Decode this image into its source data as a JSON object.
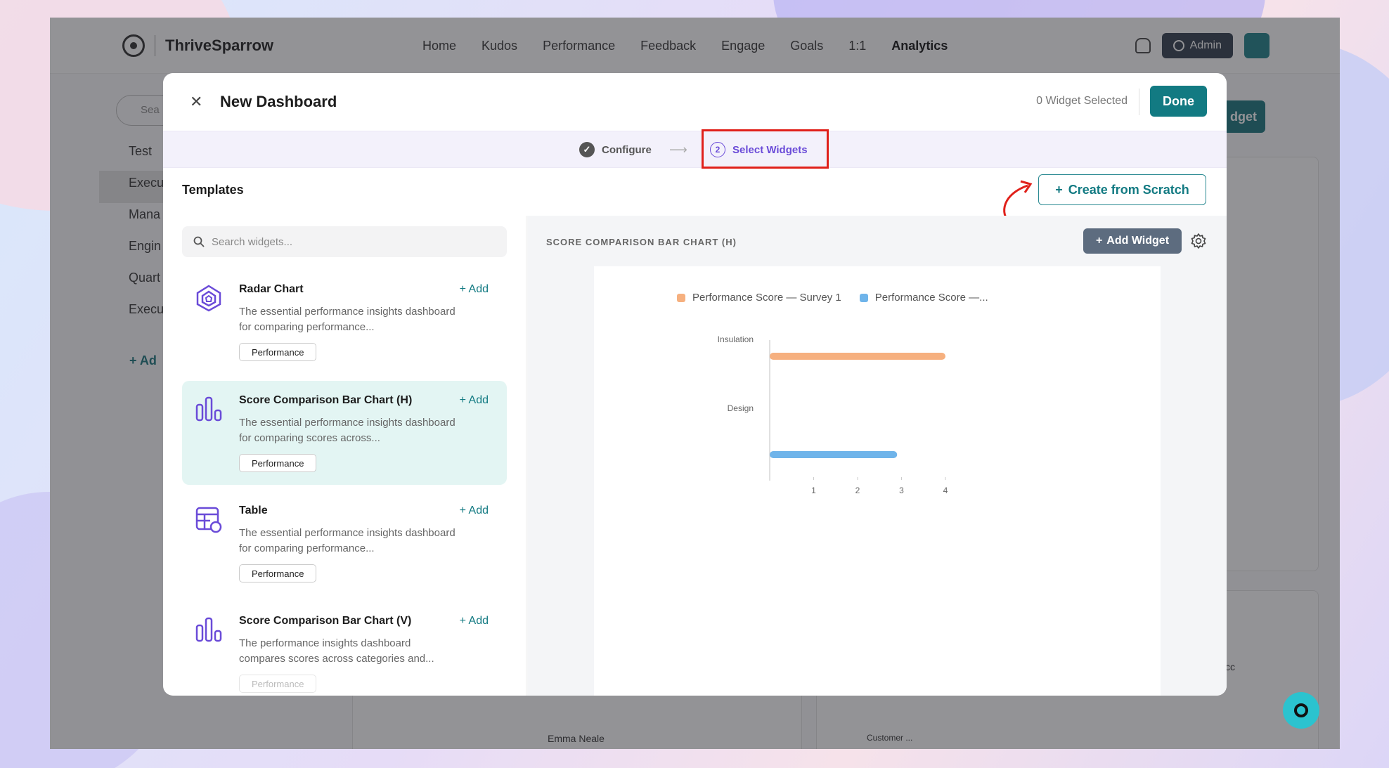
{
  "app": {
    "brand": "ThriveSparrow",
    "nav": [
      "Home",
      "Kudos",
      "Performance",
      "Feedback",
      "Engage",
      "Goals",
      "1:1",
      "Analytics"
    ],
    "active_nav": "Analytics",
    "admin_label": "Admin",
    "sidebar_items": [
      "Test",
      "Execu",
      "Mana",
      "Engin",
      "Quart",
      "Execu"
    ],
    "sidebar_add": "+ Ad",
    "search_placeholder": "Sea",
    "widget_btn_fragment": "dget",
    "bg_text_name": "Emma Neale",
    "bg_text_customer": "Customer ...",
    "bg_text_cc": "cc"
  },
  "modal": {
    "title": "New Dashboard",
    "selected_count": "0 Widget Selected",
    "done_label": "Done",
    "steps": [
      {
        "label": "Configure",
        "state": "complete"
      },
      {
        "number": "2",
        "label": "Select Widgets",
        "state": "active"
      }
    ],
    "templates_title": "Templates",
    "create_scratch_label": "Create from Scratch",
    "search_placeholder": "Search widgets...",
    "templates": [
      {
        "name": "Radar Chart",
        "add": "+ Add",
        "desc": "The essential performance insights dashboard for comparing performance...",
        "tag": "Performance",
        "icon": "radar-icon"
      },
      {
        "name": "Score Comparison Bar Chart (H)",
        "add": "+ Add",
        "desc": "The essential performance insights dashboard for comparing scores across...",
        "tag": "Performance",
        "icon": "bar-chart-icon"
      },
      {
        "name": "Table",
        "add": "+ Add",
        "desc": "The essential performance insights dashboard for comparing performance...",
        "tag": "Performance",
        "icon": "table-icon"
      },
      {
        "name": "Score Comparison Bar Chart (V)",
        "add": "+ Add",
        "desc": "The performance insights dashboard compares scores across categories and...",
        "tag": "Performance",
        "icon": "bar-chart-icon"
      }
    ],
    "preview_title": "SCORE COMPARISON BAR CHART (H)",
    "add_widget_label": "Add Widget"
  },
  "colors": {
    "accent": "#127a82",
    "step_active": "#6a4bd8",
    "highlight_box": "#e0201a",
    "series1": "#f6b07f",
    "series2": "#6fb4ea"
  },
  "chart_data": {
    "type": "bar",
    "orientation": "horizontal",
    "categories": [
      "Insulation",
      "Design"
    ],
    "series": [
      {
        "name": "Performance Score — Survey 1",
        "values": [
          4,
          null
        ],
        "color": "#f6b07f"
      },
      {
        "name": "Performance Score —...",
        "values": [
          null,
          2.9
        ],
        "color": "#6fb4ea"
      }
    ],
    "x_ticks": [
      "1",
      "2",
      "3",
      "4"
    ],
    "xlim": [
      0,
      4
    ],
    "legend": "top",
    "grid": false
  }
}
